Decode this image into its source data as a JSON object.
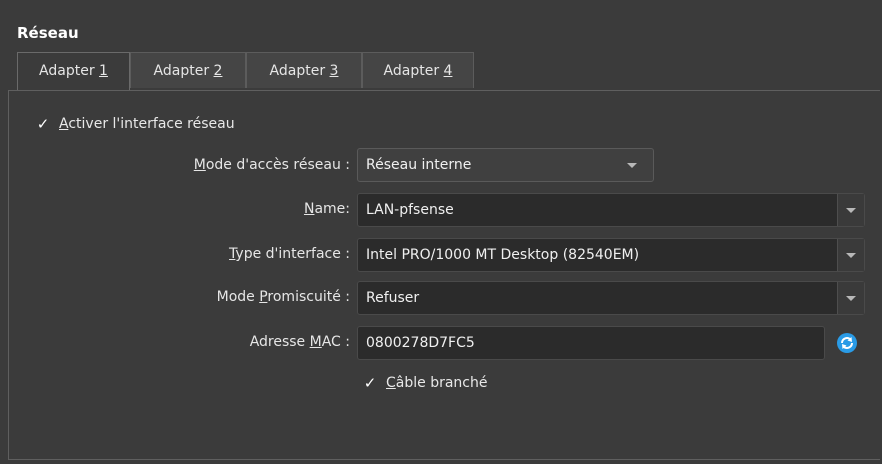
{
  "section": {
    "title": "Réseau"
  },
  "tabs": [
    {
      "prefix": "Adapter ",
      "accel": "1"
    },
    {
      "prefix": "Adapter ",
      "accel": "2"
    },
    {
      "prefix": "Adapter ",
      "accel": "3"
    },
    {
      "prefix": "Adapter ",
      "accel": "4"
    }
  ],
  "active_tab": "Adapter 1",
  "enable_interface": {
    "check": "✓",
    "accel": "A",
    "rest": "ctiver l'interface réseau",
    "checked": true
  },
  "fields": {
    "mode": {
      "accel": "M",
      "rest": "ode d'accès réseau :",
      "value": "Réseau interne"
    },
    "name": {
      "accel": "N",
      "rest": "ame:",
      "value": "LAN-pfsense"
    },
    "type": {
      "pre": "",
      "accel": "T",
      "rest": "ype d'interface :",
      "value": "Intel PRO/1000 MT Desktop (82540EM)"
    },
    "promisc": {
      "pre": "Mode ",
      "accel": "P",
      "rest": "romiscuité :",
      "value": "Refuser"
    },
    "mac": {
      "pre": "Adresse ",
      "accel": "M",
      "rest": "AC :",
      "value": "0800278D7FC5"
    }
  },
  "cable": {
    "check": "✓",
    "accel": "C",
    "rest": "âble branché",
    "checked": true
  },
  "icons": {
    "dropdown": "chevron-down-icon",
    "refresh": "refresh-icon"
  },
  "colors": {
    "accent": "#2a9be6",
    "background": "#3b3b3b",
    "field": "#2b2b2b"
  }
}
